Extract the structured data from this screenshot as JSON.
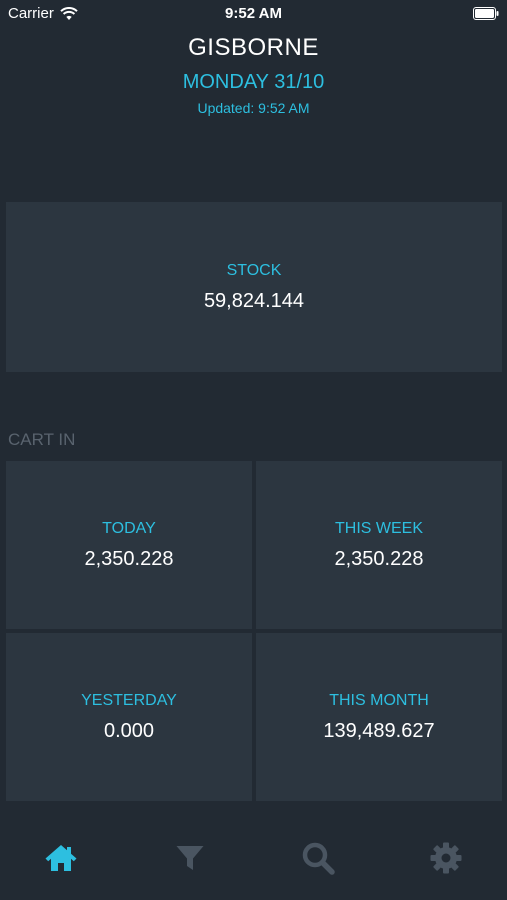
{
  "status_bar": {
    "carrier": "Carrier",
    "time": "9:52 AM"
  },
  "header": {
    "location": "GISBORNE",
    "date": "MONDAY 31/10",
    "updated": "Updated: 9:52 AM"
  },
  "stock": {
    "label": "STOCK",
    "value": "59,824.144"
  },
  "cart_in": {
    "section_label": "CART IN",
    "today": {
      "label": "TODAY",
      "value": "2,350.228"
    },
    "this_week": {
      "label": "THIS WEEK",
      "value": "2,350.228"
    },
    "yesterday": {
      "label": "YESTERDAY",
      "value": "0.000"
    },
    "this_month": {
      "label": "THIS MONTH",
      "value": "139,489.627"
    }
  },
  "tab_bar": {
    "tabs": [
      {
        "icon": "home-icon",
        "active": true
      },
      {
        "icon": "filter-icon",
        "active": false
      },
      {
        "icon": "search-icon",
        "active": false
      },
      {
        "icon": "gear-icon",
        "active": false
      }
    ]
  },
  "colors": {
    "background": "#222a33",
    "tile": "#2c3640",
    "accent": "#2dbfe0",
    "muted": "#59636e",
    "inactive_icon": "#4a5561"
  }
}
